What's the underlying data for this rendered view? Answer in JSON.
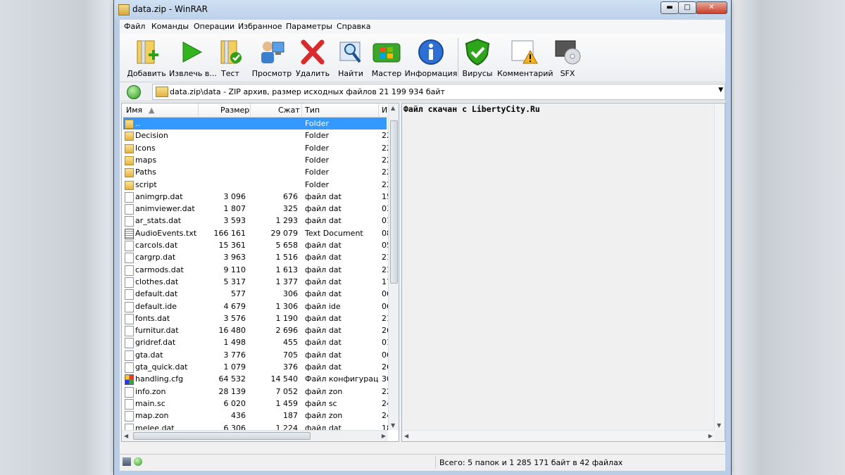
{
  "window": {
    "title": "data.zip - WinRAR",
    "min_glyph": "▬",
    "max_glyph": "□",
    "close_glyph": "✕"
  },
  "menu": [
    "Файл",
    "Команды",
    "Операции",
    "Избранное",
    "Параметры",
    "Справка"
  ],
  "toolbar": [
    {
      "label": "Добавить",
      "icon": "add-archive-icon"
    },
    {
      "label": "Извлечь в...",
      "icon": "extract-icon"
    },
    {
      "label": "Тест",
      "icon": "test-icon"
    },
    {
      "label": "Просмотр",
      "icon": "view-icon"
    },
    {
      "label": "Удалить",
      "icon": "delete-icon"
    },
    {
      "label": "Найти",
      "icon": "find-icon"
    },
    {
      "label": "Мастер",
      "icon": "wizard-icon"
    },
    {
      "label": "Информация",
      "icon": "info-icon"
    },
    {
      "label": "Вирусы",
      "icon": "virus-scan-icon"
    },
    {
      "label": "Комментарий",
      "icon": "comment-icon"
    },
    {
      "label": "SFX",
      "icon": "sfx-icon"
    }
  ],
  "address": {
    "path": "data.zip\\data - ZIP архив, размер исходных файлов 21 199 934 байт"
  },
  "columns": {
    "name": "Имя",
    "size": "Размер",
    "packed": "Сжат",
    "type": "Тип",
    "modified": "И"
  },
  "files": [
    {
      "name": "..",
      "size": "",
      "packed": "",
      "type": "Folder",
      "mod": "",
      "icon": "folder",
      "selected": true
    },
    {
      "name": "Decision",
      "size": "",
      "packed": "",
      "type": "Folder",
      "mod": "22",
      "icon": "folder"
    },
    {
      "name": "Icons",
      "size": "",
      "packed": "",
      "type": "Folder",
      "mod": "22",
      "icon": "folder"
    },
    {
      "name": "maps",
      "size": "",
      "packed": "",
      "type": "Folder",
      "mod": "22",
      "icon": "folder"
    },
    {
      "name": "Paths",
      "size": "",
      "packed": "",
      "type": "Folder",
      "mod": "22",
      "icon": "folder"
    },
    {
      "name": "script",
      "size": "",
      "packed": "",
      "type": "Folder",
      "mod": "22",
      "icon": "folder"
    },
    {
      "name": "animgrp.dat",
      "size": "3 096",
      "packed": "676",
      "type": "файл dat",
      "mod": "15",
      "icon": "file"
    },
    {
      "name": "animviewer.dat",
      "size": "1 807",
      "packed": "325",
      "type": "файл dat",
      "mod": "03",
      "icon": "file"
    },
    {
      "name": "ar_stats.dat",
      "size": "3 593",
      "packed": "1 293",
      "type": "файл dat",
      "mod": "01",
      "icon": "file"
    },
    {
      "name": "AudioEvents.txt",
      "size": "166 161",
      "packed": "29 079",
      "type": "Text Document",
      "mod": "08",
      "icon": "txt"
    },
    {
      "name": "carcols.dat",
      "size": "15 361",
      "packed": "5 658",
      "type": "файл dat",
      "mod": "05",
      "icon": "file"
    },
    {
      "name": "cargrp.dat",
      "size": "3 963",
      "packed": "1 516",
      "type": "файл dat",
      "mod": "21",
      "icon": "file"
    },
    {
      "name": "carmods.dat",
      "size": "9 110",
      "packed": "1 613",
      "type": "файл dat",
      "mod": "23",
      "icon": "file"
    },
    {
      "name": "clothes.dat",
      "size": "5 317",
      "packed": "1 377",
      "type": "файл dat",
      "mod": "17",
      "icon": "file"
    },
    {
      "name": "default.dat",
      "size": "577",
      "packed": "306",
      "type": "файл dat",
      "mod": "06",
      "icon": "file"
    },
    {
      "name": "default.ide",
      "size": "4 679",
      "packed": "1 306",
      "type": "файл ide",
      "mod": "06",
      "icon": "file"
    },
    {
      "name": "fonts.dat",
      "size": "3 576",
      "packed": "1 190",
      "type": "файл dat",
      "mod": "21",
      "icon": "file"
    },
    {
      "name": "furnitur.dat",
      "size": "16 480",
      "packed": "2 696",
      "type": "файл dat",
      "mod": "26",
      "icon": "file"
    },
    {
      "name": "gridref.dat",
      "size": "1 498",
      "packed": "455",
      "type": "файл dat",
      "mod": "01",
      "icon": "file"
    },
    {
      "name": "gta.dat",
      "size": "3 776",
      "packed": "705",
      "type": "файл dat",
      "mod": "06",
      "icon": "file"
    },
    {
      "name": "gta_quick.dat",
      "size": "1 079",
      "packed": "376",
      "type": "файл dat",
      "mod": "26",
      "icon": "file"
    },
    {
      "name": "handling.cfg",
      "size": "64 532",
      "packed": "14 540",
      "type": "Файл конфигурац...",
      "mod": "30",
      "icon": "cfg"
    },
    {
      "name": "info.zon",
      "size": "28 139",
      "packed": "7 052",
      "type": "файл zon",
      "mod": "22",
      "icon": "file"
    },
    {
      "name": "main.sc",
      "size": "6 020",
      "packed": "1 459",
      "type": "файл sc",
      "mod": "24",
      "icon": "file"
    },
    {
      "name": "map.zon",
      "size": "436",
      "packed": "187",
      "type": "файл zon",
      "mod": "24",
      "icon": "file"
    },
    {
      "name": "melee.dat",
      "size": "6 306",
      "packed": "1 224",
      "type": "файл dat",
      "mod": "18",
      "icon": "file"
    }
  ],
  "comment": "Файл скачан с LibertyCity.Ru",
  "status": {
    "text": "Всего: 5 папок и 1 285 171 байт в 42 файлах"
  },
  "colors": {
    "selection": "#3399ff",
    "titlebar": "#bcd1ea"
  }
}
